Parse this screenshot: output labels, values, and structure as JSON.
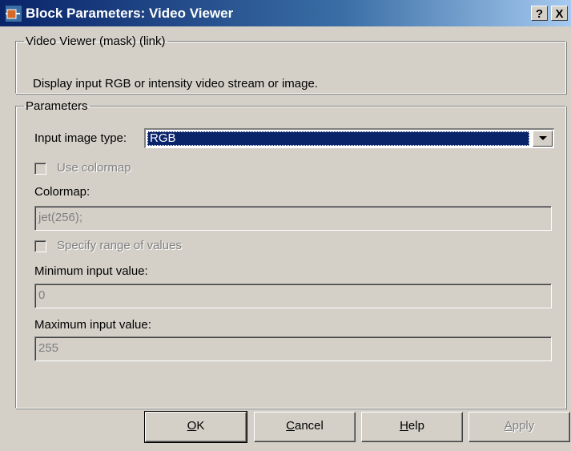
{
  "window": {
    "title": "Block Parameters: Video Viewer",
    "help_label": "?",
    "close_label": "X"
  },
  "description": {
    "legend": "Video Viewer (mask) (link)",
    "text": "Display input RGB or intensity video stream or image."
  },
  "parameters": {
    "legend": "Parameters",
    "input_image_type": {
      "label": "Input image type:",
      "value": "RGB"
    },
    "use_colormap": {
      "label": "Use colormap",
      "checked": false,
      "enabled": false
    },
    "colormap": {
      "label": "Colormap:",
      "value": "jet(256);"
    },
    "specify_range": {
      "label": "Specify range of values",
      "checked": false,
      "enabled": false
    },
    "minimum_input": {
      "label": "Minimum input value:",
      "value": "0"
    },
    "maximum_input": {
      "label": "Maximum input value:",
      "value": "255"
    }
  },
  "buttons": {
    "ok": {
      "mnemonic": "O",
      "rest": "K"
    },
    "cancel": {
      "mnemonic": "C",
      "rest": "ancel"
    },
    "help": {
      "mnemonic": "H",
      "rest": "elp"
    },
    "apply": {
      "mnemonic": "A",
      "rest": "pply",
      "enabled": false
    }
  },
  "colors": {
    "title_start": "#0a246a",
    "title_end": "#a6caf0",
    "face": "#d4d0c8",
    "selection": "#0a246a",
    "disabled_text": "#808080"
  },
  "icons": [
    "simulink-block-icon",
    "dropdown-arrow-icon"
  ]
}
